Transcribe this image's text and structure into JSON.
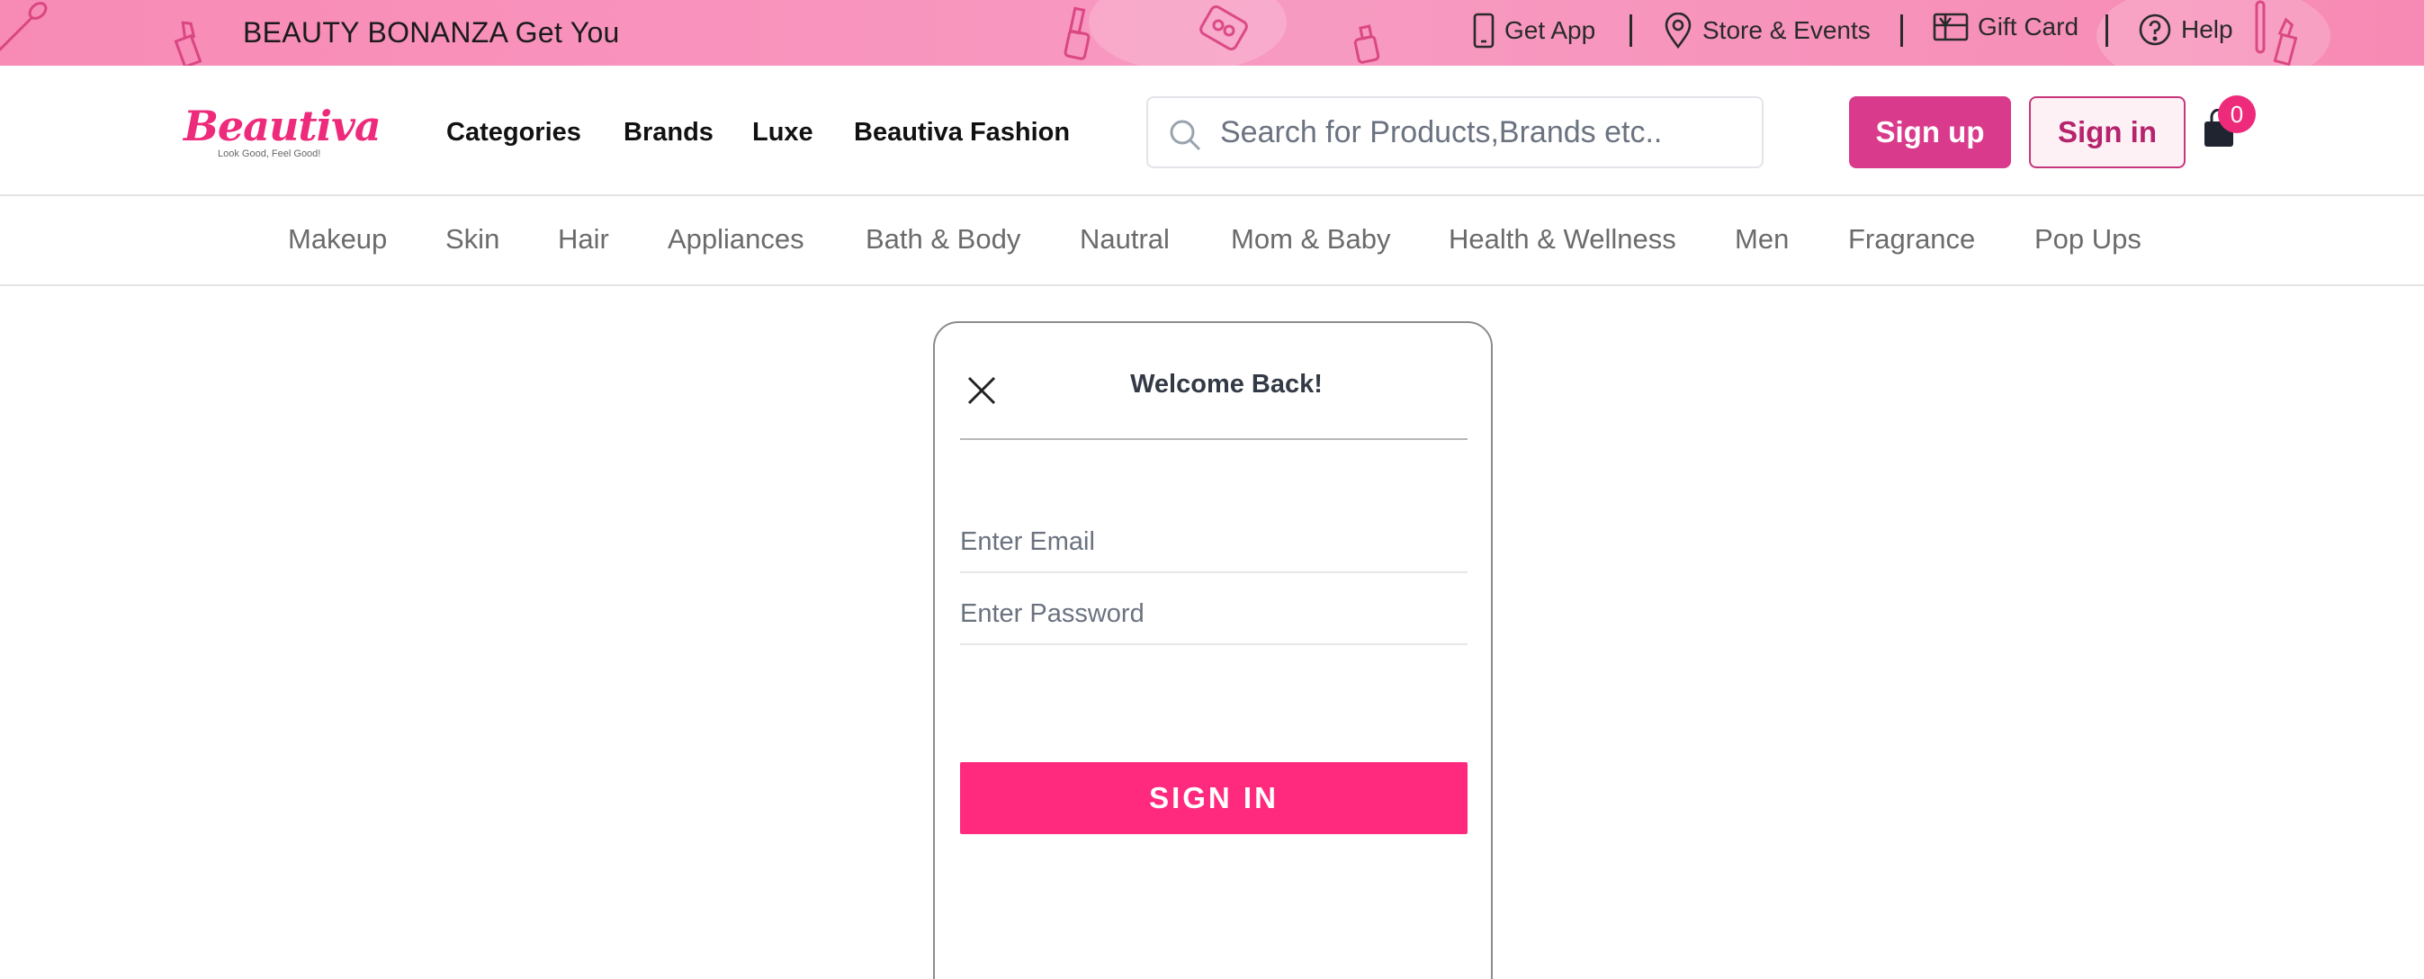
{
  "topbar": {
    "promo": "BEAUTY BONANZA Get You",
    "links": [
      {
        "label": "Get App",
        "icon": "phone-icon"
      },
      {
        "label": "Store & Events",
        "icon": "location-pin-icon"
      },
      {
        "label": "Gift Card",
        "icon": "gift-card-icon"
      },
      {
        "label": "Help",
        "icon": "help-circle-icon"
      }
    ],
    "background_color": "#f78bb5"
  },
  "header": {
    "logo_text": "Beautiva",
    "logo_tagline": "Look Good, Feel Good!",
    "nav": [
      "Categories",
      "Brands",
      "Luxe",
      "Beautiva Fashion"
    ],
    "search_placeholder": "Search for Products,Brands etc..",
    "signup_label": "Sign up",
    "signin_label": "Sign in",
    "cart_count": "0",
    "accent_color": "#ee2a7b"
  },
  "categories": [
    "Makeup",
    "Skin",
    "Hair",
    "Appliances",
    "Bath & Body",
    "Nautral",
    "Mom & Baby",
    "Health & Wellness",
    "Men",
    "Fragrance",
    "Pop Ups"
  ],
  "modal": {
    "title": "Welcome Back!",
    "email_placeholder": "Enter Email",
    "password_placeholder": "Enter Password",
    "submit_label": "SIGN IN"
  }
}
